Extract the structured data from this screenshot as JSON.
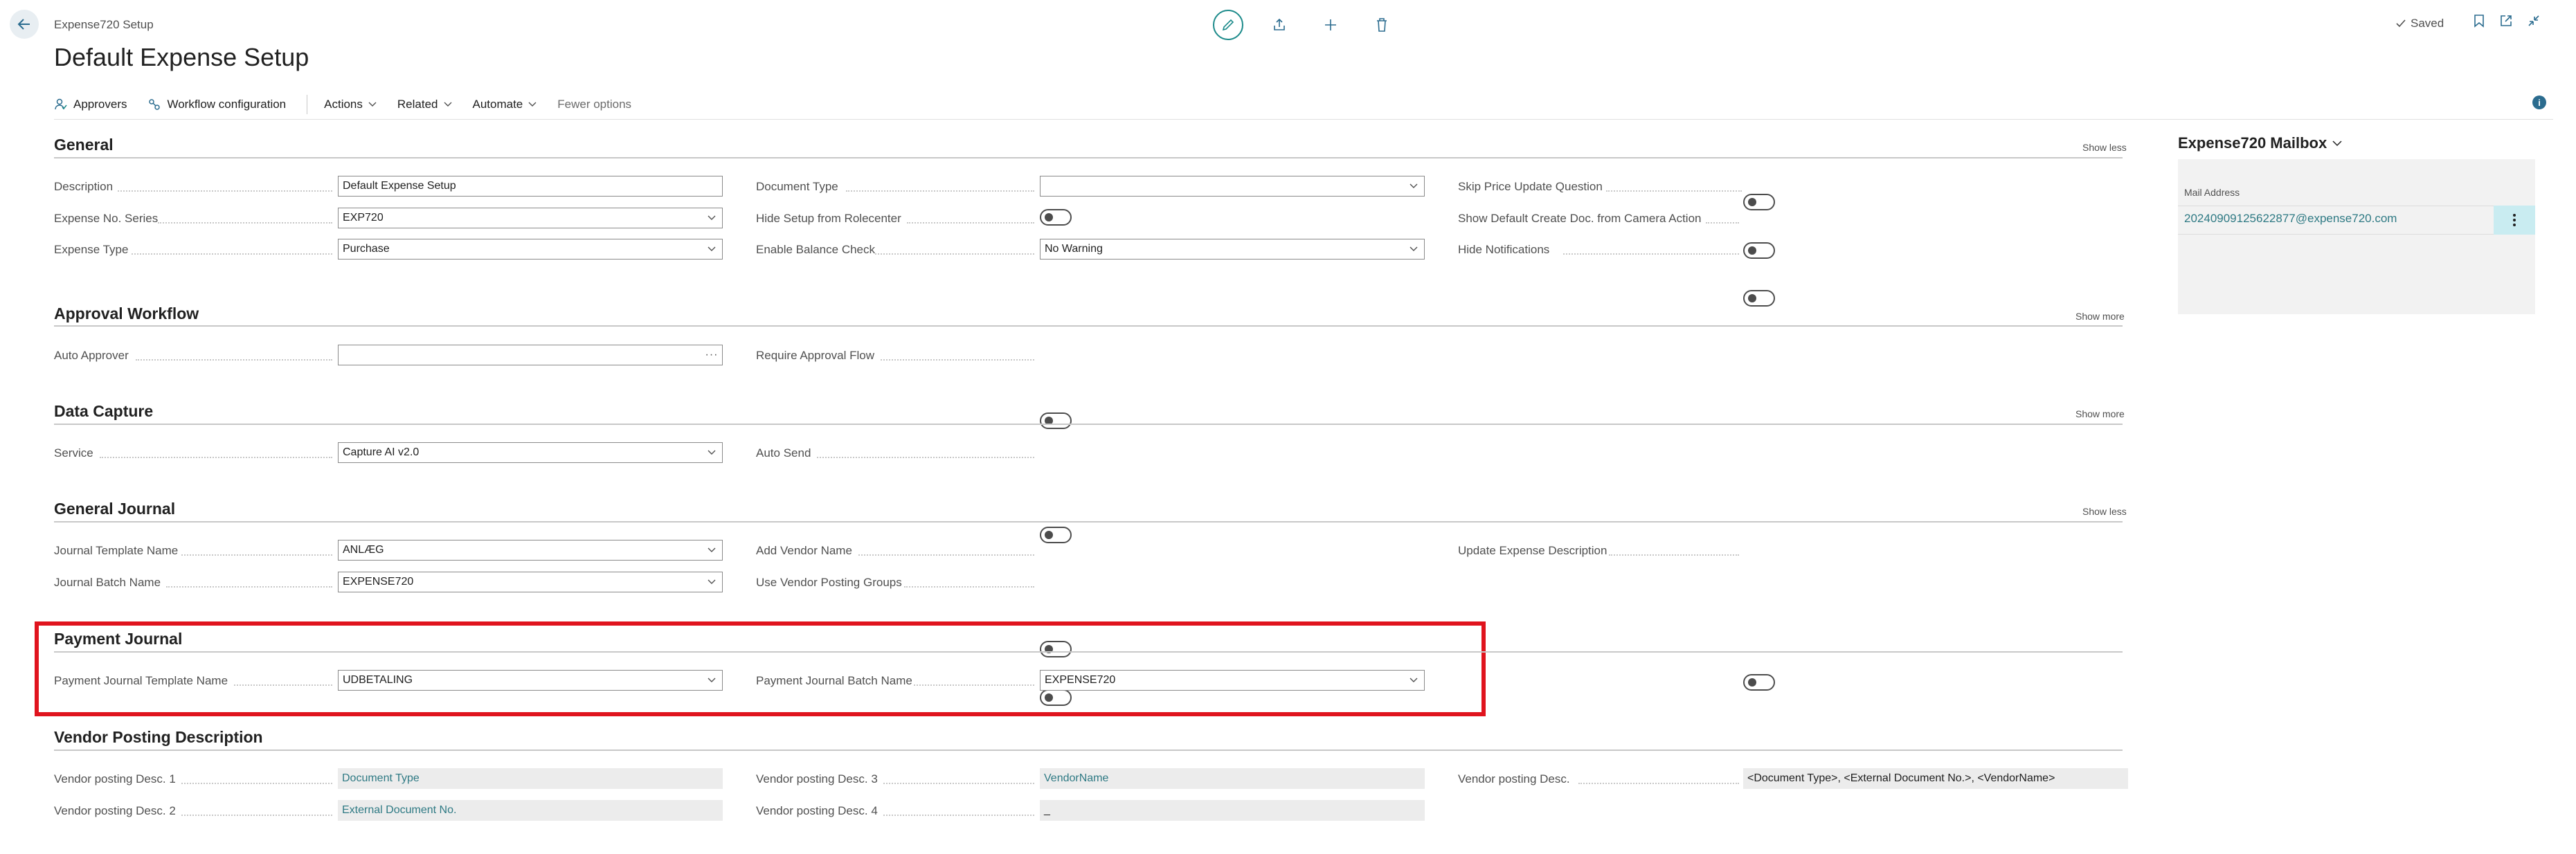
{
  "header": {
    "breadcrumb": "Expense720 Setup",
    "title": "Default Expense Setup",
    "saved_label": "Saved"
  },
  "actions": {
    "approvers": "Approvers",
    "workflow": "Workflow configuration",
    "actions": "Actions",
    "related": "Related",
    "automate": "Automate",
    "fewer": "Fewer options"
  },
  "general": {
    "title": "General",
    "show": "Show less",
    "description_label": "Description",
    "description_value": "Default Expense Setup",
    "expense_no_series_label": "Expense No. Series",
    "expense_no_series_value": "EXP720",
    "expense_type_label": "Expense Type",
    "expense_type_value": "Purchase",
    "document_type_label": "Document Type",
    "document_type_value": "",
    "hide_setup_label": "Hide Setup from Rolecenter",
    "enable_balance_label": "Enable Balance Check",
    "enable_balance_value": "No Warning",
    "skip_price_label": "Skip Price Update Question",
    "show_default_label": "Show Default Create Doc. from Camera Action",
    "hide_notifications_label": "Hide Notifications"
  },
  "approval": {
    "title": "Approval Workflow",
    "show": "Show more",
    "auto_approver_label": "Auto Approver",
    "auto_approver_value": "",
    "require_flow_label": "Require Approval Flow"
  },
  "capture": {
    "title": "Data Capture",
    "show": "Show more",
    "service_label": "Service",
    "service_value": "Capture AI v2.0",
    "auto_send_label": "Auto Send"
  },
  "gen_journal": {
    "title": "General Journal",
    "show": "Show less",
    "template_label": "Journal Template Name",
    "template_value": "ANLÆG",
    "batch_label": "Journal Batch Name",
    "batch_value": "EXPENSE720",
    "add_vendor_label": "Add Vendor Name",
    "use_vendor_posting_label": "Use Vendor Posting Groups",
    "update_desc_label": "Update Expense Description"
  },
  "payment": {
    "title": "Payment Journal",
    "template_label": "Payment Journal Template Name",
    "template_value": "UDBETALING",
    "batch_label": "Payment Journal Batch Name",
    "batch_value": "EXPENSE720"
  },
  "vendor_desc": {
    "title": "Vendor Posting Description",
    "d1_label": "Vendor posting Desc. 1",
    "d1_value": "Document Type",
    "d2_label": "Vendor posting Desc. 2",
    "d2_value": "External Document No.",
    "d3_label": "Vendor posting Desc. 3",
    "d3_value": "VendorName",
    "d4_label": "Vendor posting Desc. 4",
    "d4_value": "_",
    "desc_label": "Vendor posting Desc.",
    "desc_value": "<Document Type>, <External Document No.>, <VendorName>"
  },
  "factbox": {
    "title": "Expense720 Mailbox",
    "mail_label": "Mail Address",
    "mail_value": "20240909125622877@expense720.com"
  },
  "icons": [
    "back-arrow-icon",
    "edit-icon",
    "share-icon",
    "add-icon",
    "delete-icon",
    "check-icon",
    "bookmark-icon",
    "open-new-icon",
    "collapse-icon",
    "info-icon",
    "chevron-down-icon",
    "more-vertical-icon"
  ]
}
